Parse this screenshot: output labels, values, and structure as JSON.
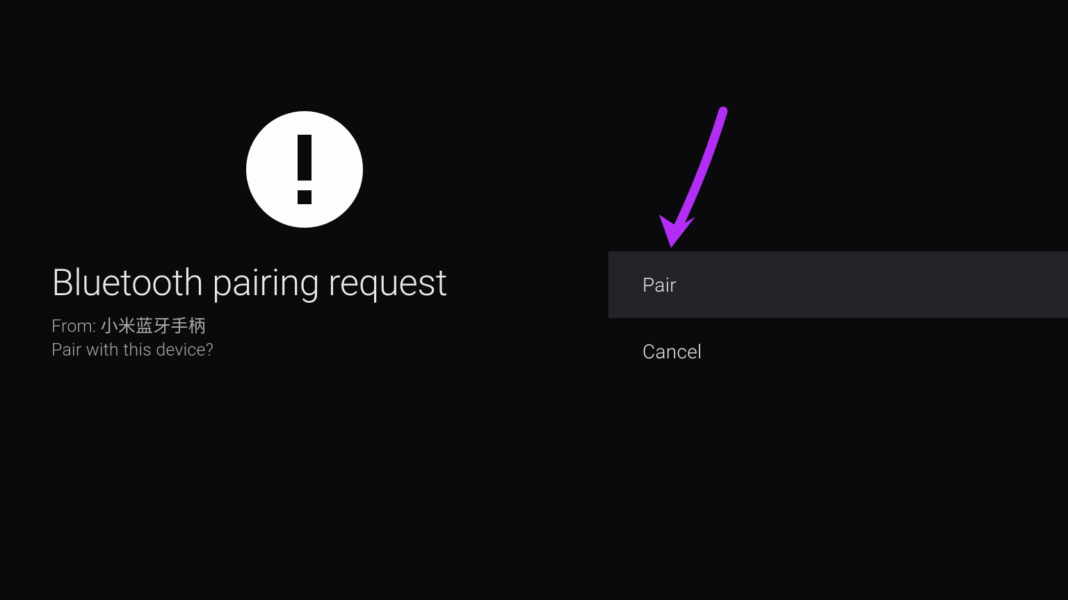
{
  "dialog": {
    "title": "Bluetooth pairing request",
    "from_line": "From: 小米蓝牙手柄",
    "prompt": "Pair with this device?"
  },
  "actions": {
    "pair_label": "Pair",
    "cancel_label": "Cancel"
  },
  "annotation": {
    "arrow_color": "#b22ef5"
  }
}
